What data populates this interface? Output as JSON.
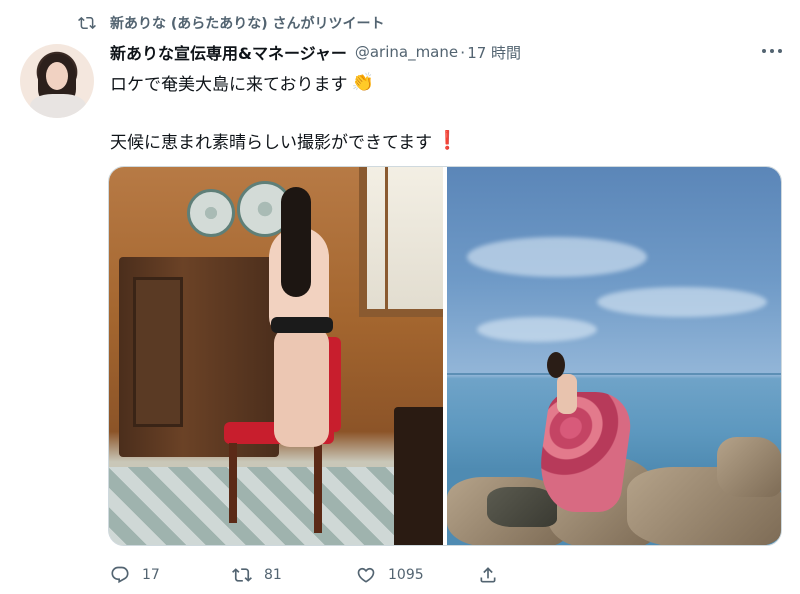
{
  "retweet": {
    "label": "新ありな (あらたありな) さんがリツイート",
    "icon": "retweet-icon"
  },
  "tweet": {
    "author_name": "新ありな宣伝専用&マネージャー",
    "handle": "@arina_mane",
    "separator": "·",
    "time": "17 時間",
    "line1": "ロケで奄美大島に来ております",
    "line1_emoji": "👏",
    "line2": "天候に恵まれ素晴らしい撮影ができてます",
    "line2_emoji": "❗"
  },
  "actions": {
    "reply_count": "17",
    "retweet_count": "81",
    "like_count": "1095"
  },
  "colors": {
    "text_primary": "#0f1419",
    "text_secondary": "#536471",
    "border": "#cfd9de",
    "exclamation": "#e0245e"
  }
}
